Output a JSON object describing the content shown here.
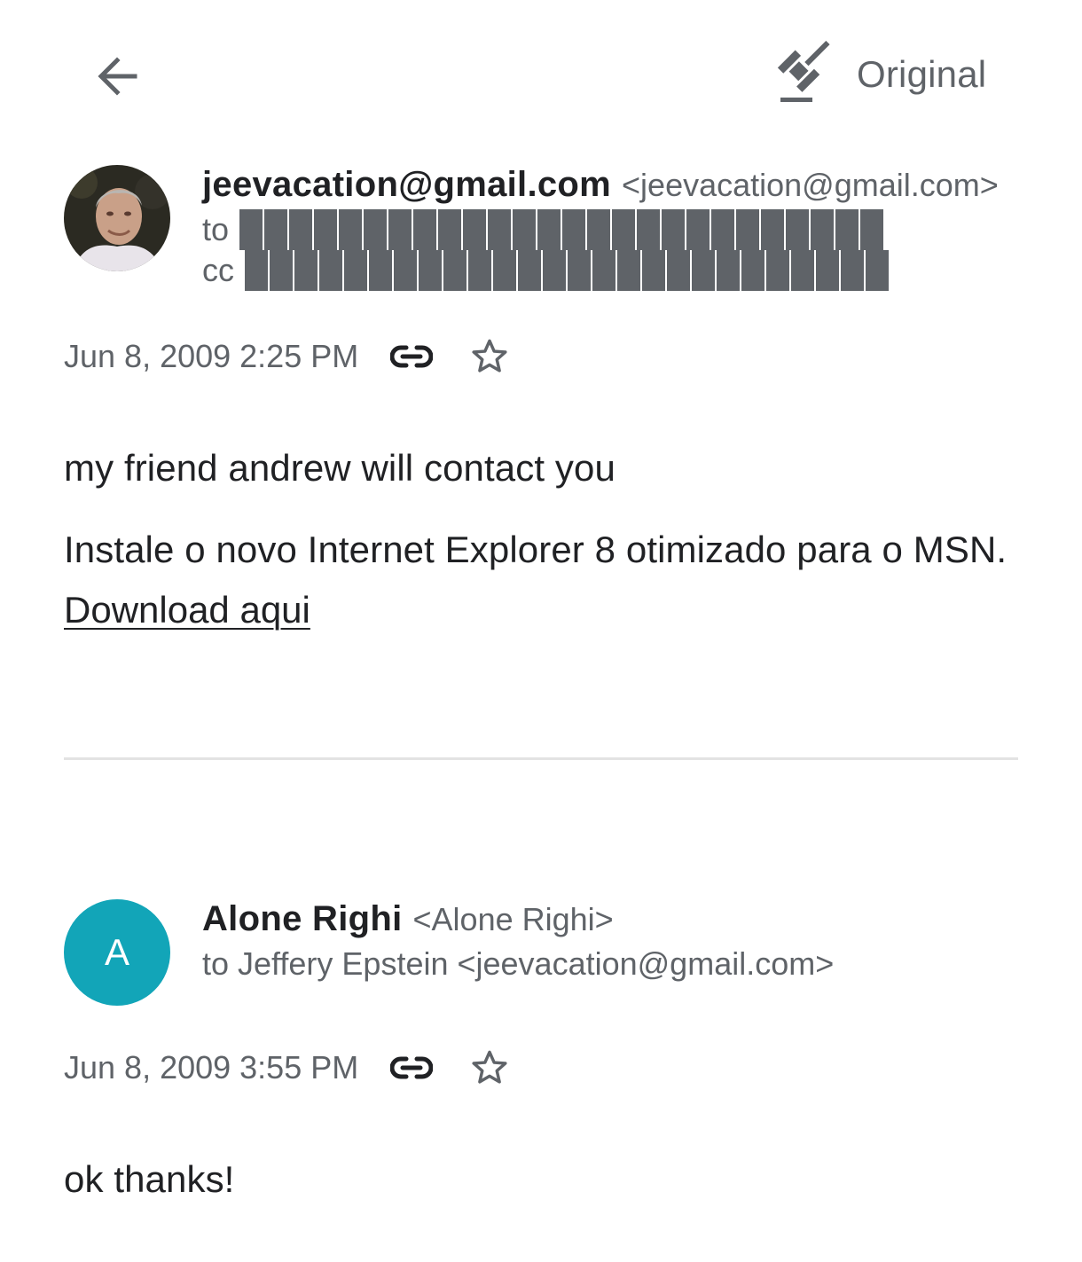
{
  "toolbar": {
    "back_icon": "arrow-left-icon",
    "original_icon": "gavel-icon",
    "original_label": "Original"
  },
  "messages": [
    {
      "sender_name": "jeevacation@gmail.com",
      "sender_email": "<jeevacation@gmail.com>",
      "to_label": "to",
      "cc_label": "cc",
      "date": "Jun 8, 2009 2:25 PM",
      "body_lines": [
        "my friend andrew will contact you",
        "Instale o novo Internet Explorer 8 otimizado para o MSN."
      ],
      "link_text": "Download aqui"
    },
    {
      "avatar_letter": "A",
      "avatar_color": "#12a5b8",
      "sender_name": "Alone Righi",
      "sender_email": "<Alone Righi>",
      "recipient_line": "to Jeffery Epstein <jeevacation@gmail.com>",
      "date": "Jun 8, 2009 3:55 PM",
      "body_lines": [
        "ok thanks!"
      ]
    }
  ],
  "colors": {
    "primary_text": "#202124",
    "secondary_text": "#5f6368",
    "divider": "#e3e3e3"
  }
}
